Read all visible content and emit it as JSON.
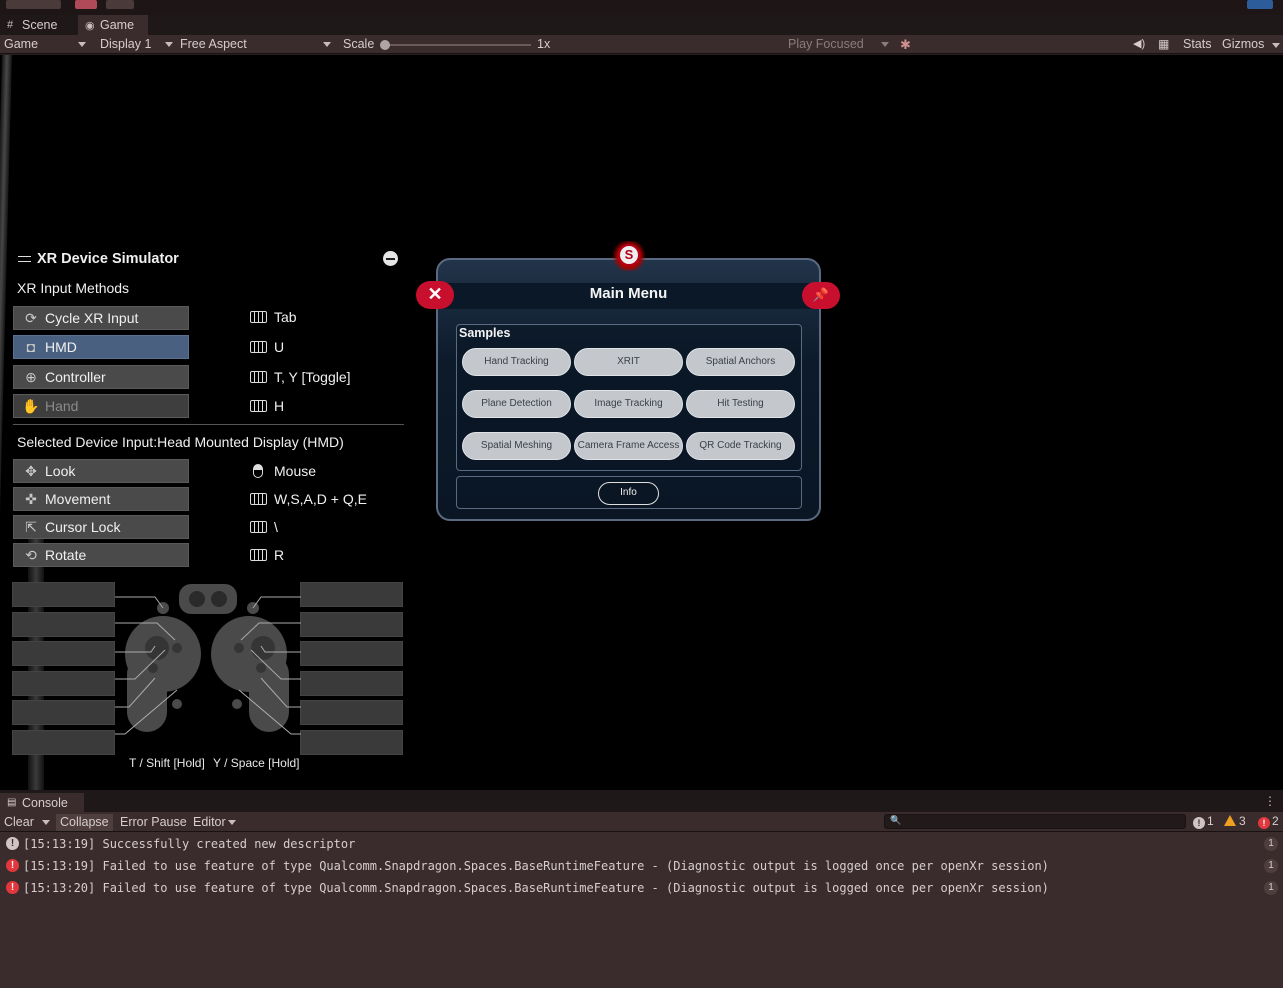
{
  "tabs": [
    {
      "label": "Scene",
      "icon": "grid-icon"
    },
    {
      "label": "Game",
      "icon": "gamepad-icon"
    }
  ],
  "toolbar": {
    "game_dropdown": "Game",
    "display_dropdown": "Display 1",
    "aspect_dropdown": "Free Aspect",
    "scale_label": "Scale",
    "scale_value": "1x",
    "play_mode": "Play Focused",
    "stats_label": "Stats",
    "gizmos_label": "Gizmos"
  },
  "simulator": {
    "title": "XR Device Simulator",
    "input_methods_label": "XR Input Methods",
    "methods": [
      {
        "label": "Cycle XR Input",
        "key": "Tab",
        "icon": "cycle-icon",
        "state": "normal"
      },
      {
        "label": "HMD",
        "key": "U",
        "icon": "headset-icon",
        "state": "selected"
      },
      {
        "label": "Controller",
        "key": "T, Y [Toggle]",
        "icon": "controller-icon",
        "state": "normal"
      },
      {
        "label": "Hand",
        "key": "H",
        "icon": "hand-icon",
        "state": "disabled"
      }
    ],
    "selected_device_label": "Selected Device Input:Head Mounted Display (HMD)",
    "device_inputs": [
      {
        "label": "Look",
        "key": "Mouse",
        "icon": "look-icon",
        "key_icon": "mouse"
      },
      {
        "label": "Movement",
        "key": "W,S,A,D + Q,E",
        "icon": "move-icon",
        "key_icon": "keyboard"
      },
      {
        "label": "Cursor Lock",
        "key": "\\",
        "icon": "cursor-icon",
        "key_icon": "keyboard"
      },
      {
        "label": "Rotate",
        "key": "R",
        "icon": "rotate-icon",
        "key_icon": "keyboard"
      }
    ],
    "left_controller_caption": "T / Shift [Hold]",
    "right_controller_caption": "Y / Space [Hold]"
  },
  "main_menu": {
    "title": "Main Menu",
    "logo_glyph": "S",
    "samples_label": "Samples",
    "samples": [
      "Hand Tracking",
      "XRIT",
      "Spatial Anchors",
      "Plane Detection",
      "Image Tracking",
      "Hit Testing",
      "Spatial Meshing",
      "Camera Frame Access",
      "QR Code Tracking"
    ],
    "info_label": "Info",
    "accent_color": "#c8102e"
  },
  "console": {
    "tab_label": "Console",
    "clear_label": "Clear",
    "collapse_label": "Collapse",
    "error_pause_label": "Error Pause",
    "editor_label": "Editor",
    "search_value": "",
    "info_count": "1",
    "warning_count": "3",
    "error_count": "2",
    "logs": [
      {
        "type": "info",
        "text": "[15:13:19] Successfully created new descriptor",
        "count": "1"
      },
      {
        "type": "error",
        "text": "[15:13:19] Failed to use feature of type Qualcomm.Snapdragon.Spaces.BaseRuntimeFeature - (Diagnostic output is logged once per openXr session)",
        "count": "1"
      },
      {
        "type": "error",
        "text": "[15:13:20] Failed to use feature of type Qualcomm.Snapdragon.Spaces.BaseRuntimeFeature - (Diagnostic output is logged once per openXr session)",
        "count": "1"
      }
    ]
  }
}
